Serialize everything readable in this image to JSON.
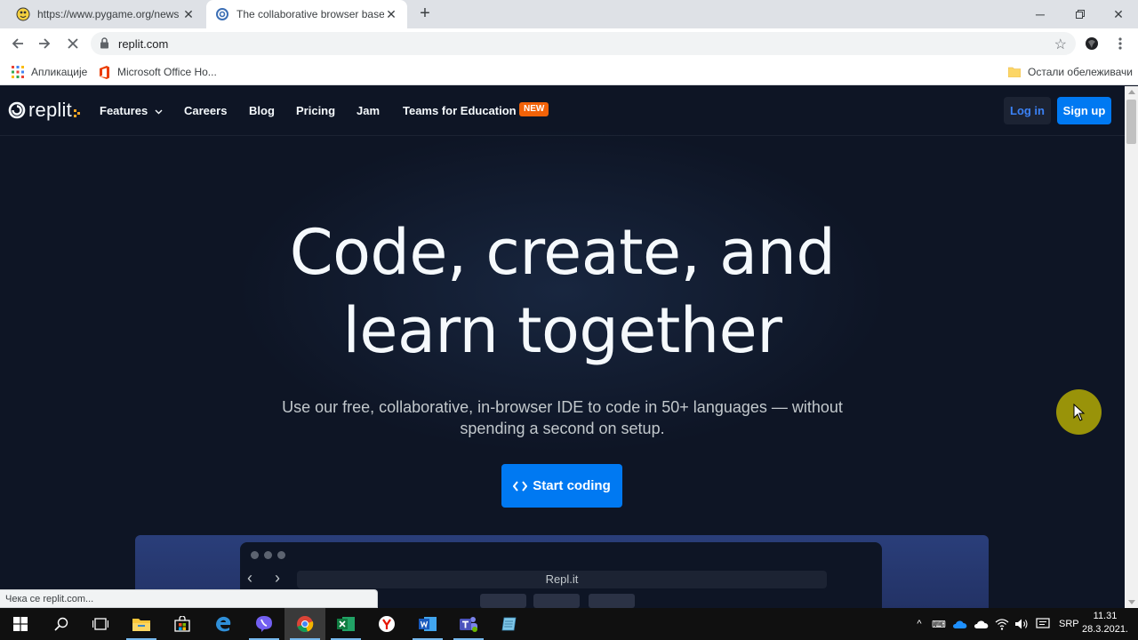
{
  "browser": {
    "tabs": [
      {
        "title": "https://www.pygame.org/news",
        "icon": "pygame-snake-icon",
        "active": false
      },
      {
        "title": "The collaborative browser based",
        "icon": "replit-icon",
        "active": true
      }
    ],
    "url": "replit.com",
    "bookmarks": [
      {
        "label": "Апликације",
        "icon": "apps-grid-icon"
      },
      {
        "label": "Microsoft Office Ho...",
        "icon": "office-icon"
      }
    ],
    "other_bookmarks": "Остали обележивачи",
    "status_text": "Чека се replit.com..."
  },
  "site": {
    "logo_text": "replit",
    "nav": [
      {
        "label": "Features",
        "has_dropdown": true
      },
      {
        "label": "Careers"
      },
      {
        "label": "Blog"
      },
      {
        "label": "Pricing"
      },
      {
        "label": "Jam"
      },
      {
        "label": "Teams for Education"
      }
    ],
    "new_badge": "NEW",
    "login_label": "Log in",
    "signup_label": "Sign up",
    "hero_title_line1": "Code, create, and",
    "hero_title_line2": "learn together",
    "hero_subtitle": "Use our free, collaborative, in-browser IDE to code in 50+ languages — without spending a second on setup.",
    "cta_label": "Start coding",
    "mock_url": "Repl.it"
  },
  "taskbar": {
    "apps": [
      "start-icon",
      "search-icon",
      "task-view-icon",
      "file-explorer-icon",
      "store-icon",
      "edge-icon",
      "viber-icon",
      "chrome-icon",
      "excel-icon",
      "yandex-icon",
      "word-icon",
      "teams-icon",
      "notepad-icon"
    ],
    "language": "SRP",
    "time": "11.31",
    "date": "28.3.2021."
  },
  "colors": {
    "page_bg": "#0e1525",
    "accent_blue": "#0079f2",
    "new_badge": "#f26208"
  }
}
